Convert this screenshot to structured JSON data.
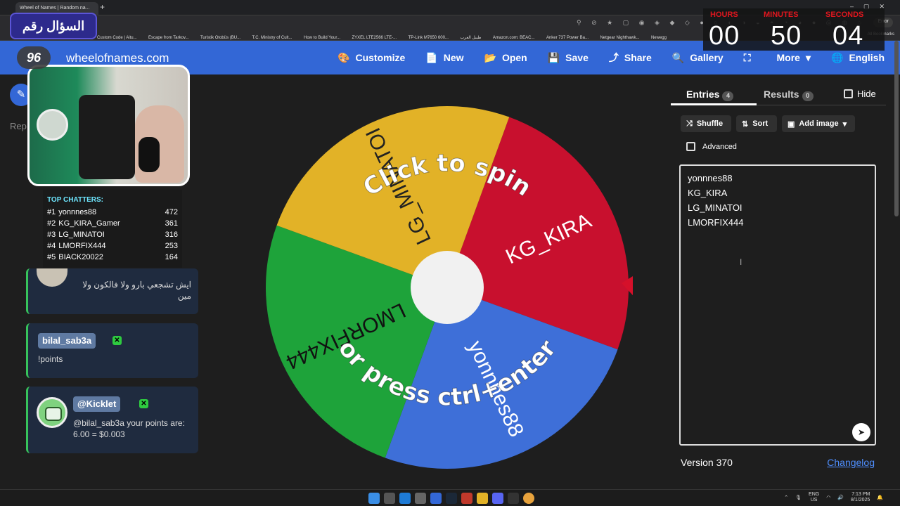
{
  "browser": {
    "tab_title": "Wheel of Names | Random na...",
    "error_label": "Error",
    "bookmarks": [
      "Custom Code | Aitu...",
      "Escape from Tarkov...",
      "Turistik Otobüs (BU...",
      "T.C. Ministry of Cult...",
      "How to Build Your...",
      "ZYXEL LTE2566 LTE-...",
      "TP-Link M7650 600...",
      "طيبل العرب",
      "Amazon.com: BEAC...",
      "Anker 737 Power Ba...",
      "Netgear Nighthawk...",
      "Newegg"
    ],
    "all_bookmarks": "All Bookmarks"
  },
  "site": {
    "logo": "wheelofnames.com",
    "nav": [
      {
        "label": "Customize",
        "icon": "palette-icon",
        "glyph": "🎨"
      },
      {
        "label": "New",
        "icon": "file-icon",
        "glyph": "📄"
      },
      {
        "label": "Open",
        "icon": "folder-open-icon",
        "glyph": "📂"
      },
      {
        "label": "Save",
        "icon": "save-icon",
        "glyph": "💾"
      },
      {
        "label": "Share",
        "icon": "share-icon",
        "glyph": "⤴"
      },
      {
        "label": "Gallery",
        "icon": "search-icon",
        "glyph": "🔍"
      },
      {
        "label": "",
        "icon": "fullscreen-icon",
        "glyph": "⛶"
      },
      {
        "label": "More",
        "icon": "chevron-down-icon",
        "glyph": "▾"
      },
      {
        "label": "English",
        "icon": "globe-icon",
        "glyph": "🌐"
      }
    ],
    "sidebar_partial_label": "Rep"
  },
  "overlay": {
    "question_title": "السؤال رقم",
    "logo_text": "96",
    "timer": {
      "hours_label": "HOURS",
      "minutes_label": "MINUTES",
      "seconds_label": "SECONDS",
      "hours": "00",
      "minutes": "50",
      "seconds": "04"
    }
  },
  "top_chatters": {
    "title": "TOP CHATTERS:",
    "rows": [
      {
        "rank": "#1",
        "name": "yonnnes88",
        "count": "472"
      },
      {
        "rank": "#2",
        "name": "KG_KIRA_Gamer",
        "count": "361"
      },
      {
        "rank": "#3",
        "name": "LG_MINATOI",
        "count": "316"
      },
      {
        "rank": "#4",
        "name": "LMORFIX444",
        "count": "253"
      },
      {
        "rank": "#5",
        "name": "BIACK20022",
        "count": "164"
      }
    ]
  },
  "chat": {
    "msg1": "ايش تشجعي بارو ولا فالكون ولا مين",
    "msg2_user": "bilal_sab3a",
    "msg2_text": "!points",
    "msg3_user": "@Kicklet",
    "msg3_text": "@bilal_sab3a your points are: 6.00 = $0.003"
  },
  "wheel": {
    "center_text_top": "Click to spin",
    "center_text_bottom": "or press ctrl+enter",
    "slices": [
      {
        "label": "KG_KIRA",
        "color": "#c8102e"
      },
      {
        "label": "yonnnes88",
        "color": "#3e6fd8"
      },
      {
        "label": "LMORFIX444",
        "color": "#1ea33a"
      },
      {
        "label": "LG_MINATOI",
        "color": "#e2b227"
      }
    ],
    "pointer_color": "#d5102a"
  },
  "panel": {
    "tab_entries": "Entries",
    "entries_count": "4",
    "tab_results": "Results",
    "results_count": "0",
    "hide_label": "Hide",
    "shuffle_label": "Shuffle",
    "sort_label": "Sort",
    "add_image_label": "Add image",
    "advanced_label": "Advanced",
    "entries": [
      "yonnnes88",
      "KG_KIRA",
      "LG_MINATOI",
      "LMORFIX444"
    ],
    "version": "Version 370",
    "changelog": "Changelog"
  },
  "taskbar": {
    "lang_line1": "ENG",
    "lang_line2": "US",
    "time": "7:13 PM",
    "date": "8/1/2025"
  }
}
